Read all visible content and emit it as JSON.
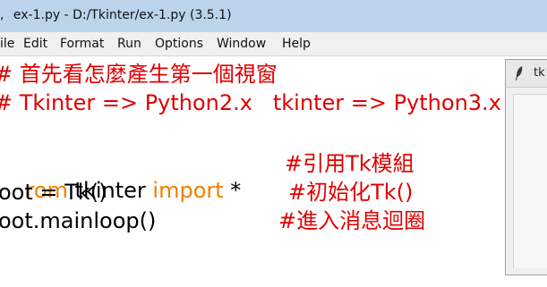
{
  "window": {
    "title": "ex-1.py - D:/Tkinter/ex-1.py (3.5.1)",
    "title_prefix": ","
  },
  "menu": {
    "items": [
      "ile",
      "Edit",
      "Format",
      "Run",
      "Options",
      "Window",
      "Help"
    ]
  },
  "code": {
    "line1": "# 首先看怎麼產生第一個視窗",
    "line2": "# Tkinter => Python2.x   tkinter => Python3.x",
    "line4_kw1": "rom",
    "line4_mod": " tkinter ",
    "line4_kw2": "import",
    "line4_star": " *",
    "line4_cmt": "#引用Tk模組",
    "line5_code": "oot = Tk()",
    "line5_cmt": "#初始化Tk()",
    "line6_code": "oot.mainloop()",
    "line6_cmt": "#進入消息迴圈"
  },
  "tk_window": {
    "title": "tk"
  },
  "colors": {
    "comment": "#e00000",
    "keyword": "#ef7f00",
    "titlebar": "#bcd3ec"
  }
}
